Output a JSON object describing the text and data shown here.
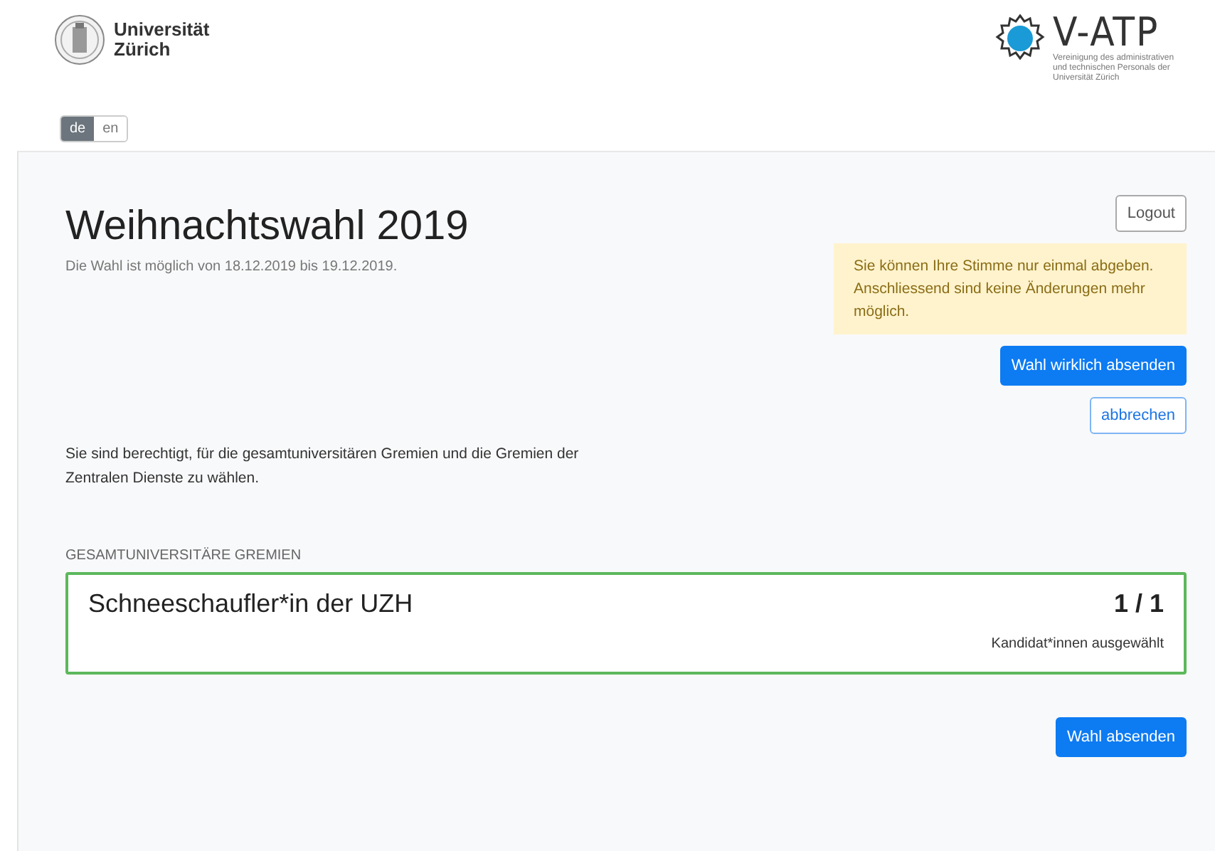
{
  "header": {
    "uni_logo": {
      "line_1": "Universität",
      "line_2": "Zürich"
    },
    "partner_logo": {
      "name": "V-ATP",
      "tagline": "Vereinigung des administrativen und technischen Personals der Universität Zürich"
    },
    "languages": [
      {
        "label": "de",
        "selected": true
      },
      {
        "label": "en",
        "selected": false
      }
    ]
  },
  "election": {
    "title": "Weihnachtswahl 2019",
    "period": "Die Wahl ist möglich von 18.12.2019 bis 19.12.2019.",
    "logout": "Logout",
    "warning": "Sie können Ihre Stimme nur einmal abgeben. Anschliessend sind keine Änderungen mehr möglich.",
    "confirm_button": "Wahl wirklich absenden",
    "cancel_button": "abbrechen",
    "eligibility": "Sie sind berechtigt, für die gesamtuniversitären Gremien und die Gremien der Zentralen Dienste zu wählen.",
    "sections": [
      {
        "heading": "GESAMTUNIVERSITÄRE GREMIEN",
        "committees": [
          {
            "name": "Schneeschaufler*in der UZH",
            "count": "1 / 1",
            "count_label": "Kandidat*innen ausgewählt",
            "complete": true
          }
        ]
      }
    ],
    "submit_button": "Wahl absenden"
  }
}
